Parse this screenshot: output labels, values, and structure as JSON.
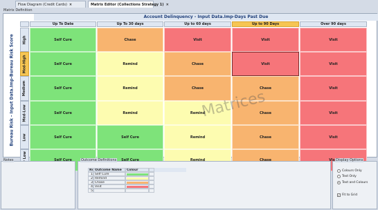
{
  "tabs": [
    {
      "label": "Flow Diagram (Credit Cards)",
      "close": "×"
    },
    {
      "label": "Matrix Editor (Collections Strategy 1)",
      "close": "×"
    }
  ],
  "subtitle": "Matrix Definition",
  "matrix": {
    "header": "Account Delinquency - Input Data.Imp-Days Past Due",
    "side_title": "Bureau Risk - Input Data.Imp-Bureau Risk Score",
    "columns": [
      "Up To Date",
      "Up To 30 days",
      "Up to 60 days",
      "Up to 90 Days",
      "Over 90 days"
    ],
    "rows": [
      "High",
      "Med-High",
      "Medium",
      "Med-Low",
      "Low",
      "Very Low"
    ],
    "cells": [
      [
        "Self Cure",
        "Chase",
        "Visit",
        "Visit",
        "Visit"
      ],
      [
        "Self Cure",
        "Remind",
        "Chase",
        "Visit",
        "Visit"
      ],
      [
        "Self Cure",
        "Remind",
        "Chase",
        "Chase",
        "Visit"
      ],
      [
        "Self Cure",
        "Remind",
        "Remind",
        "Chase",
        "Visit"
      ],
      [
        "Self Cure",
        "Self Cure",
        "Remind",
        "Chase",
        "Visit"
      ],
      [
        "Self Cure",
        "Self Cure",
        "Remind",
        "Chase",
        "Visit"
      ]
    ],
    "watermark": "Matrices"
  },
  "colors": {
    "Self Cure": "#7ee37a",
    "Remind": "#fdfcb0",
    "Chase": "#f8b46f",
    "Visit": "#f6757a",
    "header_bg": "#dfe7f2",
    "selected": "#f6c553"
  },
  "notes_label": "Notes",
  "outcomes": {
    "label": "Outcome Definitions",
    "headers": [
      "Ref",
      "Outcome Name",
      "Colour"
    ],
    "rows": [
      {
        "ref": "1",
        "name": "Self Cure",
        "color": "#7ee37a"
      },
      {
        "ref": "2",
        "name": "Remind",
        "color": "#fdfcb0"
      },
      {
        "ref": "3",
        "name": "Chase",
        "color": "#f8b46f"
      },
      {
        "ref": "4",
        "name": "Visit",
        "color": "#f6757a"
      },
      {
        "ref": "5",
        "name": "",
        "color": ""
      }
    ]
  },
  "display": {
    "label": "Display Options",
    "options": [
      "Colours Only",
      "Text Only",
      "Text and Colours"
    ],
    "selected": "Text and Colours",
    "fit_to_grid": "Fit to Grid"
  }
}
